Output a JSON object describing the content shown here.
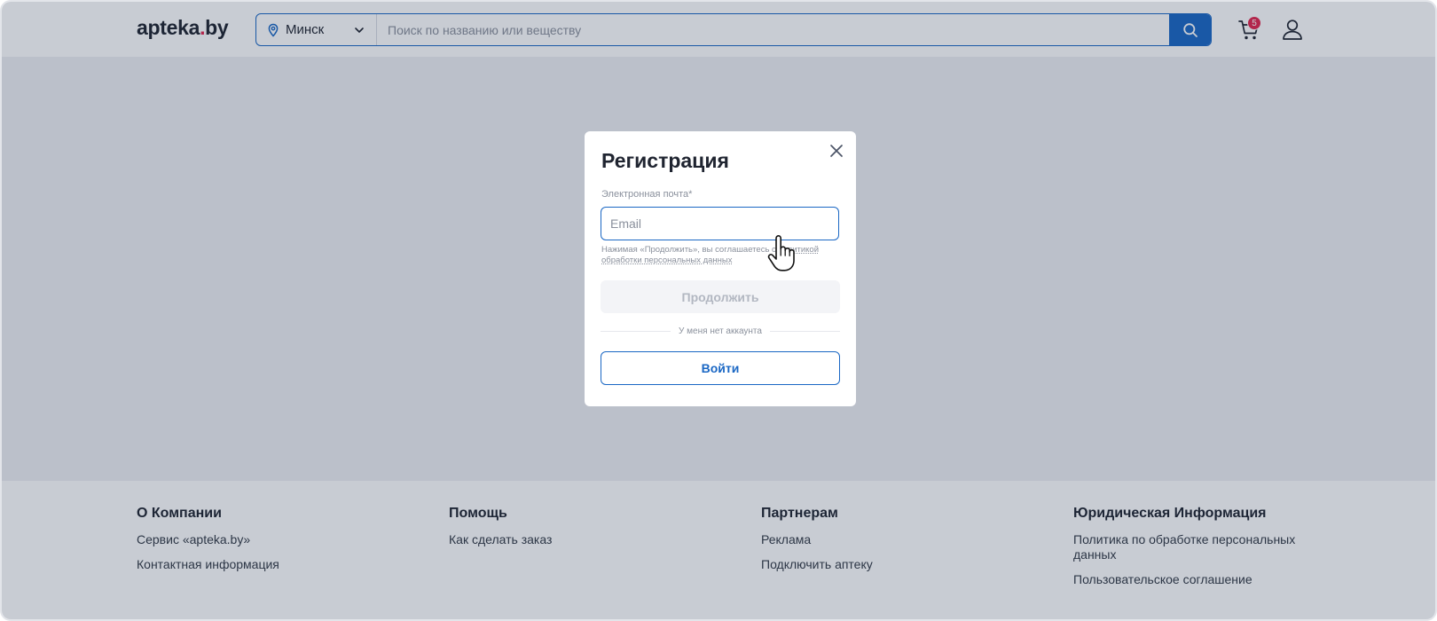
{
  "header": {
    "logo_main": "apteka",
    "logo_dot": ".",
    "logo_tld": "by",
    "city": "Минск",
    "search_placeholder": "Поиск по названию или веществу",
    "cart_count": "5",
    "icons": [
      "map-pin-icon",
      "chevron-down-icon",
      "search-icon",
      "cart-icon",
      "user-icon"
    ]
  },
  "modal": {
    "title": "Регистрация",
    "email_label": "Электронная почта*",
    "email_placeholder": "Email",
    "email_value": "",
    "consent_prefix": "Нажимая «Продолжить», вы соглашаетесь с ",
    "consent_link": "политикой обработки персональных данных",
    "continue_label": "Продолжить",
    "divider_text": "У меня нет аккаунта",
    "login_label": "Войти"
  },
  "footer": {
    "columns": [
      {
        "title": "О Компании",
        "links": [
          "Сервис «apteka.by»",
          "Контактная информация"
        ]
      },
      {
        "title": "Помощь",
        "links": [
          "Как сделать заказ"
        ]
      },
      {
        "title": "Партнерам",
        "links": [
          "Реклама",
          "Подключить аптеку"
        ]
      },
      {
        "title": "Юридическая Информация",
        "links": [
          "Политика по обработке персональных данных",
          "Пользовательское соглашение"
        ]
      }
    ]
  },
  "colors": {
    "accent": "#1a67c4",
    "brand_dot": "#e3264e",
    "overlay": "rgba(24, 40, 72, 0.24)",
    "text": "#1f2430",
    "muted": "#8a909c"
  }
}
